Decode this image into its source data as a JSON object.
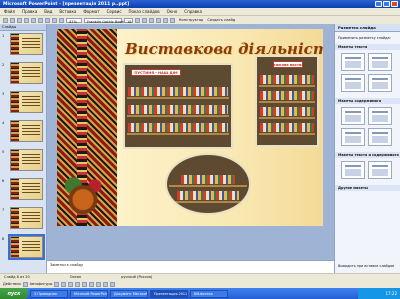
{
  "window": {
    "title": "Microsoft PowerPoint - [презентація 2011 р..ppt]"
  },
  "menu": [
    "Файл",
    "Правка",
    "Вид",
    "Вставка",
    "Формат",
    "Сервис",
    "Показ слайдов",
    "Окно",
    "Справка"
  ],
  "toolbar": {
    "zoom": "47%",
    "font": "Franklin Gothic Book",
    "size": "18",
    "design_label": "Конструктор",
    "new_slide_label": "Создать слайд"
  },
  "outline": {
    "tab_label": "Слайды",
    "slide_numbers": [
      "1",
      "2",
      "3",
      "4",
      "5",
      "6",
      "7",
      "8"
    ]
  },
  "slide": {
    "title": "Виставкова діяльність",
    "banner_text": "ПУСТИНЯ - НАШ ДІМ",
    "banner2_text": "Книжкова виставка"
  },
  "notes": {
    "placeholder": "Заметки к слайду"
  },
  "taskpane": {
    "title": "Разметка слайда",
    "apply_label": "Применить разметку слайда:",
    "section_text": "Макеты текста",
    "section_content": "Макеты содержимого",
    "section_text_content": "Макеты текста и содержимого",
    "section_other": "Другие макеты",
    "show_on_insert": "Выводить при вставке слайдов"
  },
  "status": {
    "slide": "Слайд 8 из 20",
    "design": "Океан",
    "language": "русский (Россия)"
  },
  "drawbar": {
    "actions": "Действия",
    "autoshapes": "Автофигуры"
  },
  "taskbar": {
    "start": "пуск",
    "tasks": [
      "3 Проводник",
      "Microsoft PowerPoint",
      "Документ Microsoft",
      "Презентация 2011",
      "Бібліотека"
    ],
    "clock": "17:22"
  }
}
